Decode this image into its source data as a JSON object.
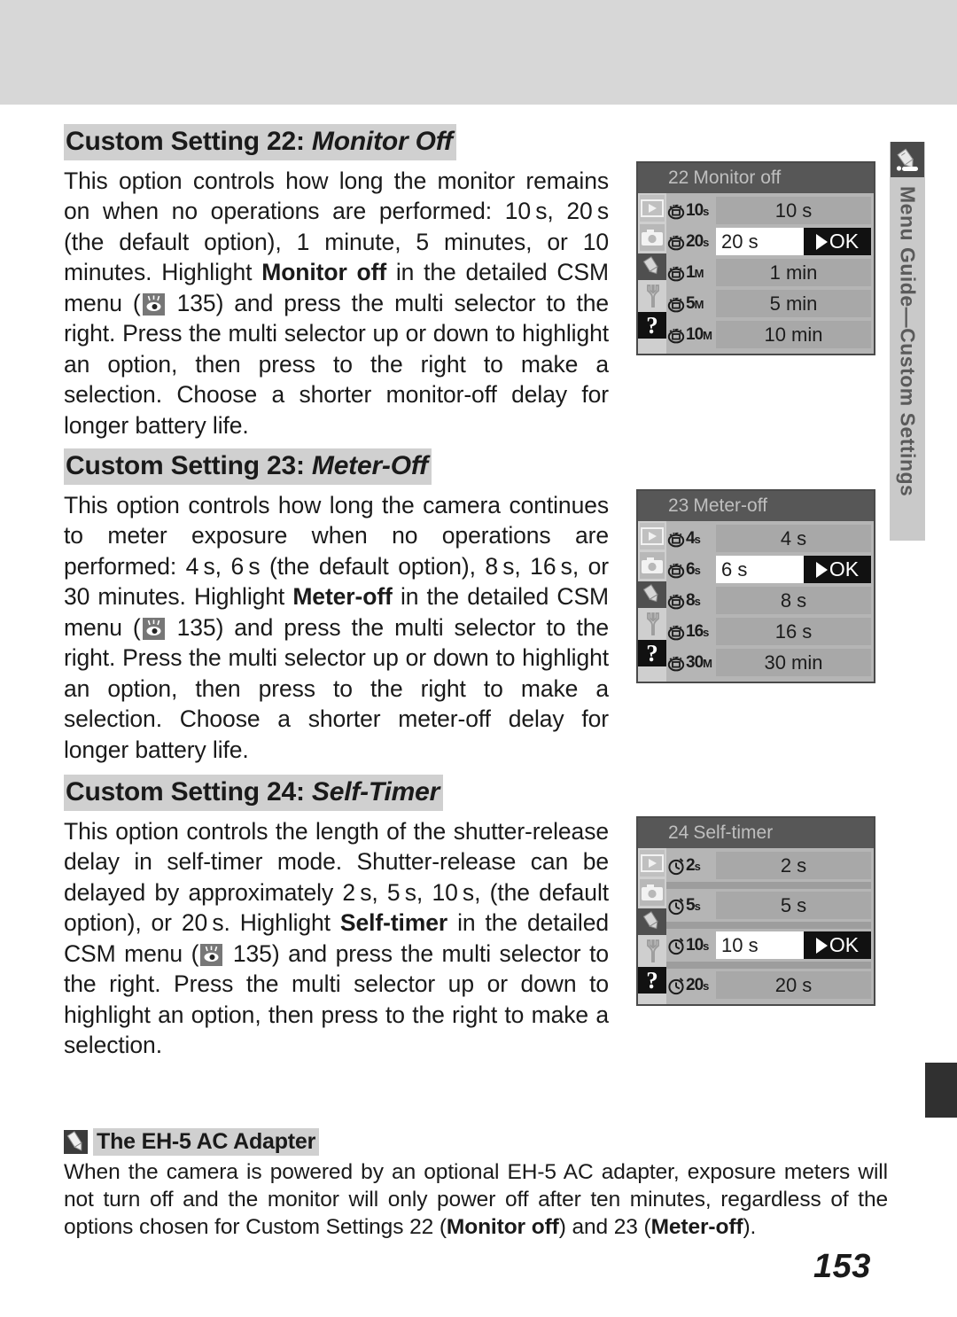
{
  "page": {
    "number": "153",
    "side_tab_label": "Menu Guide—Custom Settings",
    "side_tab_icon": "pencil-icon"
  },
  "sections": [
    {
      "id": "cs22",
      "heading_prefix": "Custom Setting 22:",
      "heading_title": "Monitor Off",
      "body_1": "This option controls how long the monitor remains on when no operations are performed: 10 s, 20 s (the default option), 1 minute, 5 minutes, or 10 minutes.  Highlight ",
      "body_bold": "Monitor off",
      "body_2": " in the detailed CSM menu (",
      "body_ref": "135",
      "body_3": ") and press the multi selector to the right.  Press the multi selector up or down to highlight an option, then press to the right to make a selection.  Choose a shorter monitor-off delay for longer battery life."
    },
    {
      "id": "cs23",
      "heading_prefix": "Custom Setting 23:",
      "heading_title": "Meter-Off",
      "body_1": "This option controls how long the camera continues to meter exposure when no operations are performed: 4 s, 6 s (the default option), 8 s, 16 s, or 30 minutes.  Highlight ",
      "body_bold": "Meter-off",
      "body_2": " in the detailed CSM menu (",
      "body_ref": "135",
      "body_3": ") and press the multi selector to the right.  Press the multi selector up or down to highlight an option, then press to the right to make a selection.  Choose a shorter meter-off delay for longer battery life."
    },
    {
      "id": "cs24",
      "heading_prefix": "Custom Setting 24:",
      "heading_title": "Self-Timer",
      "body_1": "This option controls the length of the shutter-release delay in self-timer mode.  Shutter-release can be delayed by approximately 2 s, 5 s, 10 s, (the default option), or 20 s.  Highlight ",
      "body_bold": "Self-timer",
      "body_2": " in the detailed CSM menu (",
      "body_ref": "135",
      "body_3": ") and press the multi selector to the right.  Press the multi selector up or down to highlight an option, then press to the right to make a selection."
    }
  ],
  "lcd_screens": [
    {
      "id": "lcd-monitor-off",
      "title_num": "22",
      "title": "Monitor off",
      "rail_icons": [
        "playback-icon",
        "camera-icon",
        "pencil-icon",
        "wrench-icon",
        "question-icon"
      ],
      "rows": [
        {
          "tag": "10",
          "unit": "s",
          "value": "10 s",
          "selected": false,
          "ok": ""
        },
        {
          "tag": "20",
          "unit": "s",
          "value": "20 s",
          "selected": true,
          "ok": "OK"
        },
        {
          "tag": "1",
          "unit": "M",
          "value": "1 min",
          "selected": false,
          "ok": ""
        },
        {
          "tag": "5",
          "unit": "M",
          "value": "5 min",
          "selected": false,
          "ok": ""
        },
        {
          "tag": "10",
          "unit": "M",
          "value": "10 min",
          "selected": false,
          "ok": ""
        }
      ]
    },
    {
      "id": "lcd-meter-off",
      "title_num": "23",
      "title": "Meter-off",
      "rail_icons": [
        "playback-icon",
        "camera-icon",
        "pencil-icon",
        "wrench-icon",
        "question-icon"
      ],
      "rows": [
        {
          "tag": "4",
          "unit": "s",
          "value": "4 s",
          "selected": false,
          "ok": ""
        },
        {
          "tag": "6",
          "unit": "s",
          "value": "6 s",
          "selected": true,
          "ok": "OK"
        },
        {
          "tag": "8",
          "unit": "s",
          "value": "8 s",
          "selected": false,
          "ok": ""
        },
        {
          "tag": "16",
          "unit": "s",
          "value": "16 s",
          "selected": false,
          "ok": ""
        },
        {
          "tag": "30",
          "unit": "M",
          "value": "30 min",
          "selected": false,
          "ok": ""
        }
      ]
    },
    {
      "id": "lcd-self-timer",
      "title_num": "24",
      "title": "Self-timer",
      "rail_icons": [
        "playback-icon",
        "camera-icon",
        "pencil-icon",
        "wrench-icon",
        "question-icon"
      ],
      "rows": [
        {
          "tag": "2",
          "unit": "s",
          "value": "2 s",
          "selected": false,
          "ok": ""
        },
        {
          "tag": "5",
          "unit": "s",
          "value": "5 s",
          "selected": false,
          "ok": ""
        },
        {
          "tag": "10",
          "unit": "s",
          "value": "10 s",
          "selected": true,
          "ok": "OK"
        },
        {
          "tag": "20",
          "unit": "s",
          "value": "20 s",
          "selected": false,
          "ok": ""
        }
      ]
    }
  ],
  "note": {
    "icon": "pencil-note-icon",
    "title": "The EH-5 AC Adapter",
    "body_1": "When the camera is powered by an optional EH-5 AC adapter, exposure meters will not turn off and the monitor will only power off after ten minutes, regardless of the options chosen for Custom Settings 22 (",
    "bold_1": "Monitor off",
    "body_2": ") and 23 (",
    "bold_2": "Meter-off",
    "body_3": ")."
  },
  "colors": {
    "band": "#d7d7d7",
    "heading_highlight": "#d0d0d0",
    "lcd_bg": "#b5b5b5",
    "lcd_title_bg": "#575757",
    "selected_bg": "#ffffff",
    "ok_bg": "#111111"
  }
}
